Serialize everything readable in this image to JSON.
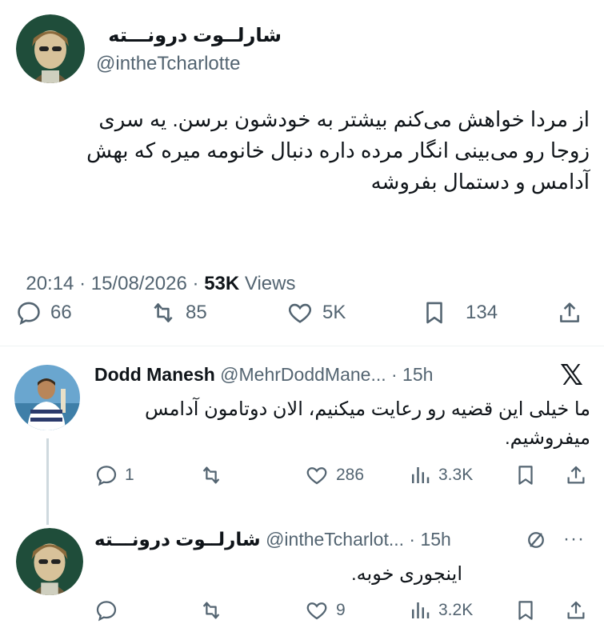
{
  "main_tweet": {
    "display_name": "شارلــوت درونـــته",
    "handle": "@intheTcharlotte",
    "text_lines": [
      "از مردا خواهش می‌کنم بیشتر به خودشون برسن. یه سری",
      "زوجا رو می‌بینی انگار مرده داره دنبال خانومه میره که بهش",
      "آدامس و دستمال بفروشه"
    ],
    "timestamp": "20:14 · 15/08/2026 · ",
    "views_count": "53K",
    "views_label": " Views",
    "actions": {
      "replies": "66",
      "retweets": "85",
      "likes": "5K",
      "bookmarks": "134"
    }
  },
  "reply_1": {
    "display_name": "Dodd Manesh",
    "handle_time": "@MehrDoddMane... · 15h",
    "text_lines": [
      "ما خیلی این قضیه رو رعایت میکنیم، الان دوتامون آدامس",
      "میفروشیم."
    ],
    "actions": {
      "replies": "1",
      "retweets": "",
      "likes": "286",
      "views": "3.3K"
    }
  },
  "reply_2": {
    "display_name": "شارلــوت درونـــته",
    "handle_time": "@intheTcharlot... · 15h",
    "more": "···",
    "text_lines": [
      "اینجوری خوبه."
    ],
    "actions": {
      "replies": "",
      "retweets": "",
      "likes": "9",
      "views": "3.2K"
    }
  },
  "colors": {
    "text": "#0f1419",
    "muted": "#536471",
    "divider": "#eff3f4",
    "thread": "#cfd9de"
  }
}
